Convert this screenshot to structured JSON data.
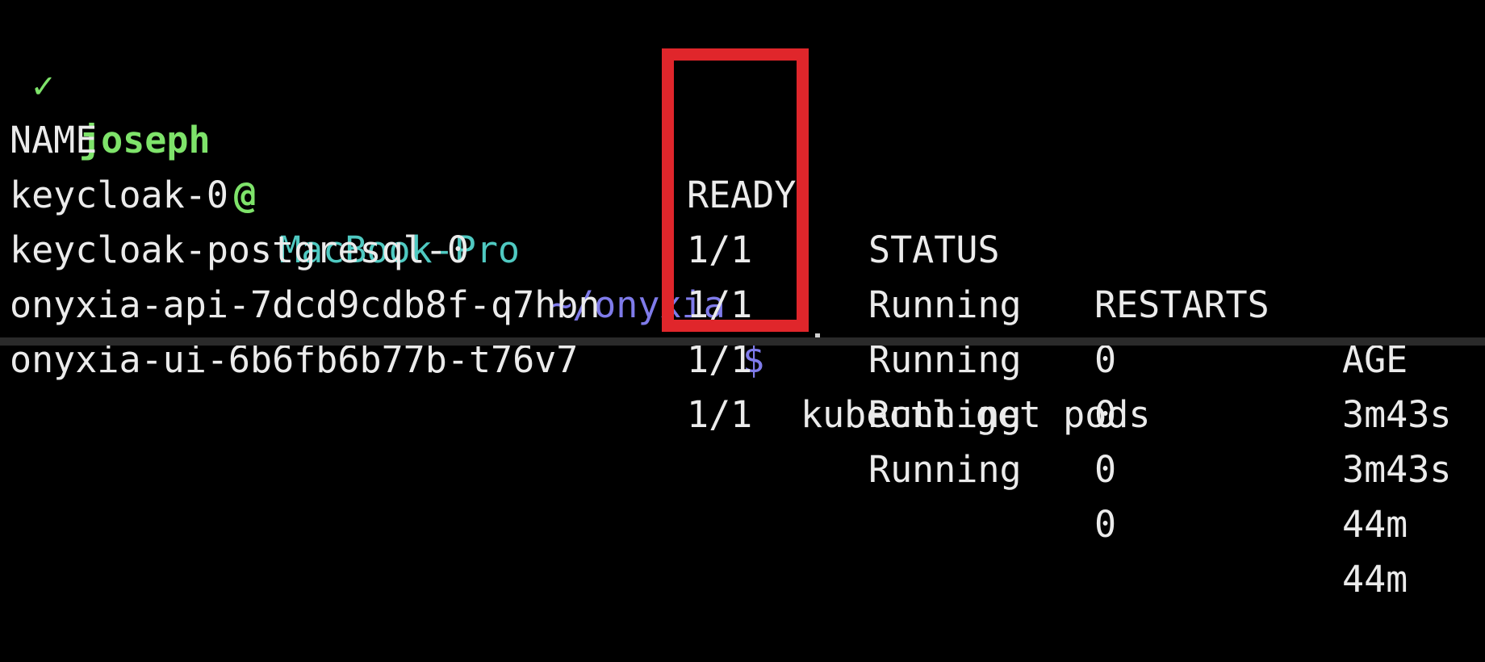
{
  "prompt": {
    "check": "✓",
    "user": "joseph",
    "at": "@",
    "host": "MacBook-Pro",
    "directory": "~/onyxia",
    "symbol": "$",
    "command": "kubectl get pods"
  },
  "table": {
    "headers": {
      "name": "NAME",
      "ready": "READY",
      "status": "STATUS",
      "restarts": "RESTARTS",
      "age": "AGE"
    },
    "rows": [
      {
        "name": "keycloak-0",
        "ready": "1/1",
        "status": "Running",
        "restarts": "0",
        "age": "3m43s"
      },
      {
        "name": "keycloak-postgresql-0",
        "ready": "1/1",
        "status": "Running",
        "restarts": "0",
        "age": "3m43s"
      },
      {
        "name": "onyxia-api-7dcd9cdb8f-q7hbn",
        "ready": "1/1",
        "status": "Running",
        "restarts": "0",
        "age": "44m"
      },
      {
        "name": "onyxia-ui-6b6fb6b77b-t76v7",
        "ready": "1/1",
        "status": "Running",
        "restarts": "0",
        "age": "44m"
      }
    ]
  },
  "colors": {
    "background": "#000000",
    "text": "#ebebeb",
    "prompt_user": "#7ee36a",
    "prompt_host": "#4fc9c1",
    "prompt_dir": "#7f7bea",
    "highlight": "#e0262b"
  }
}
